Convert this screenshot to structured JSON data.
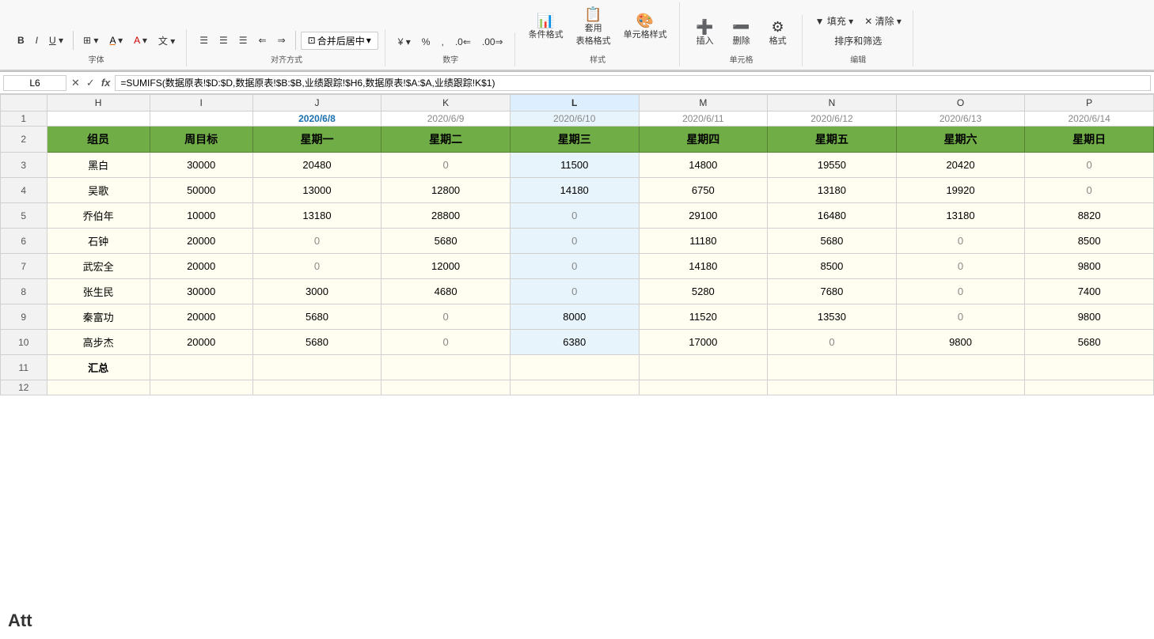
{
  "ribbon": {
    "font_group_label": "字体",
    "align_group_label": "对齐方式",
    "number_group_label": "数字",
    "style_group_label": "样式",
    "cell_group_label": "单元格",
    "edit_group_label": "编辑",
    "bold": "B",
    "italic": "I",
    "underline": "U",
    "border_btn": "⊞",
    "fill_color_btn": "A",
    "font_color_btn": "A",
    "wen_btn": "文",
    "align_left": "≡",
    "align_center": "≡",
    "align_right": "≡",
    "indent_left": "⇐",
    "indent_right": "⇒",
    "merge_btn": "合并后居中",
    "percent_btn": "%",
    "comma_btn": ",",
    "dec_inc": ".0",
    "dec_dec": ".00",
    "cond_format": "条件格式",
    "table_format": "套用\n表格格式",
    "cell_style": "单元格样式",
    "insert_btn": "插入",
    "delete_btn": "删除",
    "format_btn": "格式",
    "fill_btn": "▼ 填充▼",
    "clear_btn": "✕ 清除▼",
    "sort_filter": "排序和筛选",
    "expand_icon": "⌄"
  },
  "formula_bar": {
    "cell_ref": "L6",
    "formula": "=SUMIFS(数据原表!$D:$D,数据原表!$B:$B,业绩跟踪!$H6,数据原表!$A:$A,业绩跟踪!K$1)"
  },
  "columns": {
    "letters": [
      "H",
      "I",
      "J",
      "K",
      "L",
      "M",
      "N",
      "O",
      "P"
    ],
    "widths": [
      "80",
      "80",
      "100",
      "100",
      "100",
      "100",
      "100",
      "100",
      "100"
    ]
  },
  "dates": {
    "row": [
      "",
      "",
      "2020/6/8",
      "2020/6/9",
      "2020/6/10",
      "2020/6/11",
      "2020/6/12",
      "2020/6/13",
      "2020/6/14"
    ]
  },
  "headers": {
    "row": [
      "组员",
      "周目标",
      "星期一",
      "星期二",
      "星期三",
      "星期四",
      "星期五",
      "星期六",
      "星期日"
    ]
  },
  "data": {
    "rows": [
      {
        "name": "黑白",
        "target": "30000",
        "mon": "20480",
        "tue": "0",
        "wed": "11500",
        "thu": "14800",
        "fri": "19550",
        "sat": "20420",
        "sun": "0"
      },
      {
        "name": "吴歌",
        "target": "50000",
        "mon": "13000",
        "tue": "12800",
        "wed": "14180",
        "thu": "6750",
        "fri": "13180",
        "sat": "19920",
        "sun": "0"
      },
      {
        "name": "乔伯年",
        "target": "10000",
        "mon": "13180",
        "tue": "28800",
        "wed": "0",
        "thu": "29100",
        "fri": "16480",
        "sat": "13180",
        "sun": "8820"
      },
      {
        "name": "石钟",
        "target": "20000",
        "mon": "0",
        "tue": "5680",
        "wed": "0",
        "thu": "11180",
        "fri": "5680",
        "sat": "0",
        "sun": "8500"
      },
      {
        "name": "武宏全",
        "target": "20000",
        "mon": "0",
        "tue": "12000",
        "wed": "0",
        "thu": "14180",
        "fri": "8500",
        "sat": "0",
        "sun": "9800"
      },
      {
        "name": "张生民",
        "target": "30000",
        "mon": "3000",
        "tue": "4680",
        "wed": "0",
        "thu": "5280",
        "fri": "7680",
        "sat": "0",
        "sun": "7400"
      },
      {
        "name": "秦富功",
        "target": "20000",
        "mon": "5680",
        "tue": "0",
        "wed": "8000",
        "thu": "11520",
        "fri": "13530",
        "sat": "0",
        "sun": "9800"
      },
      {
        "name": "高步杰",
        "target": "20000",
        "mon": "5680",
        "tue": "0",
        "wed": "6380",
        "thu": "17000",
        "fri": "0",
        "sat": "9800",
        "sun": "5680"
      }
    ],
    "summary_label": "汇总"
  },
  "att_text": "Att",
  "row_numbers": {
    "date_row": "1",
    "header_row": "2",
    "data_start": 3,
    "summary_row": 11
  },
  "colors": {
    "header_bg": "#70ad47",
    "header_border": "#548135",
    "data_bg": "#fffef0",
    "active_col_bg": "#ddeeff",
    "date_active_color": "#1a6faf"
  }
}
